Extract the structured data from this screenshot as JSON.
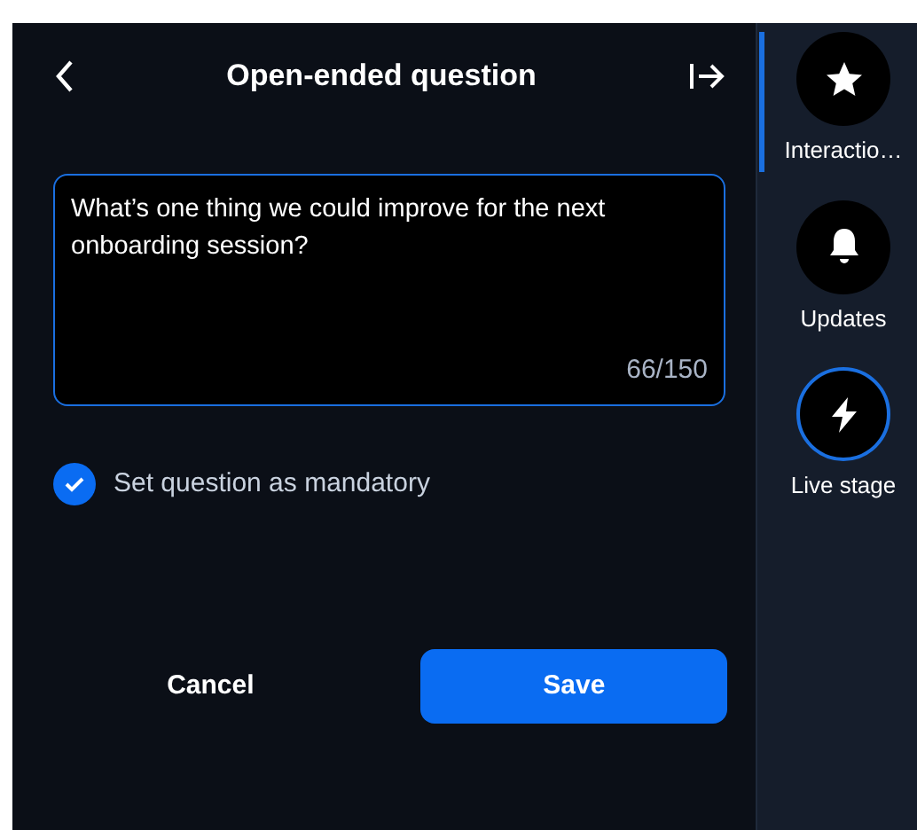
{
  "header": {
    "title": "Open-ended question"
  },
  "question": {
    "value": "What’s one thing we could improve for the next onboarding session?",
    "counter": "66/150"
  },
  "mandatory": {
    "label": "Set question as mandatory",
    "checked": true
  },
  "buttons": [
    {
      "label": "Cancel",
      "kind": "secondary"
    },
    {
      "label": "Save",
      "kind": "primary"
    }
  ],
  "sidebar": {
    "items": [
      {
        "label": "Interactio…",
        "kind": "star",
        "selected": true,
        "outlined": false
      },
      {
        "label": "Updates",
        "kind": "bell",
        "selected": false,
        "outlined": false
      },
      {
        "label": "Live stage",
        "kind": "bolt",
        "selected": false,
        "outlined": true
      }
    ]
  }
}
